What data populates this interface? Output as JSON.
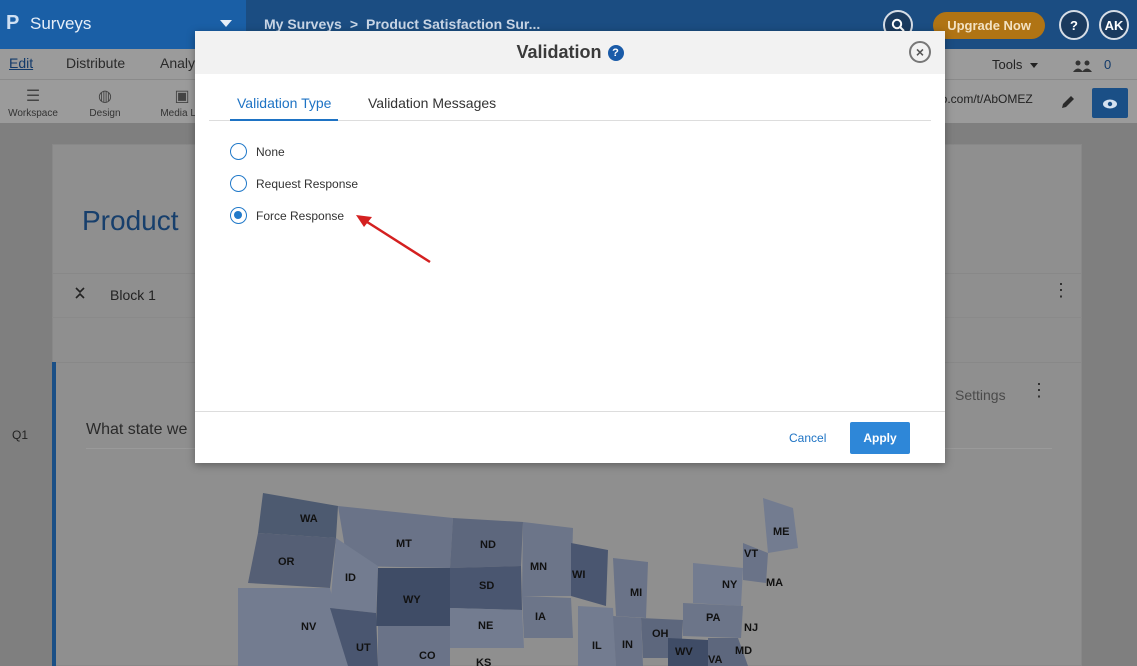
{
  "header": {
    "logo": "P",
    "app_name": "Surveys",
    "breadcrumb": [
      "My Surveys",
      "Product Satisfaction Sur..."
    ],
    "breadcrumb_sep": ">",
    "upgrade_label": "Upgrade Now",
    "help_label": "?",
    "avatar_initials": "AK"
  },
  "menubar": {
    "items": [
      "Edit",
      "Distribute",
      "Analy"
    ],
    "tools_label": "Tools",
    "people_count": "0"
  },
  "toolbar": {
    "items": [
      "Workspace",
      "Design",
      "Media Lib"
    ],
    "url_text": "pro.com/t/AbOMEZ"
  },
  "survey": {
    "title": "Product",
    "block_label": "Block 1",
    "question_number": "Q1",
    "question_text": "What state we",
    "settings_label": "Settings",
    "map_states": [
      "WA",
      "OR",
      "MT",
      "ID",
      "ND",
      "SD",
      "WY",
      "MN",
      "WI",
      "MI",
      "ME",
      "VT",
      "NY",
      "MA",
      "PA",
      "NJ",
      "OH",
      "IA",
      "IL",
      "IN",
      "NE",
      "NV",
      "UT",
      "CO",
      "KS",
      "WV",
      "VA",
      "MD"
    ]
  },
  "modal": {
    "title": "Validation",
    "help_icon": "?",
    "close_icon": "×",
    "tabs": [
      {
        "label": "Validation Type",
        "active": true
      },
      {
        "label": "Validation Messages",
        "active": false
      }
    ],
    "options": [
      {
        "label": "None",
        "checked": false
      },
      {
        "label": "Request Response",
        "checked": false
      },
      {
        "label": "Force Response",
        "checked": true
      }
    ],
    "cancel_label": "Cancel",
    "apply_label": "Apply"
  },
  "colors": {
    "accent": "#2179c9",
    "apply_button": "#2e87d8",
    "annotation_arrow": "#d42020"
  }
}
